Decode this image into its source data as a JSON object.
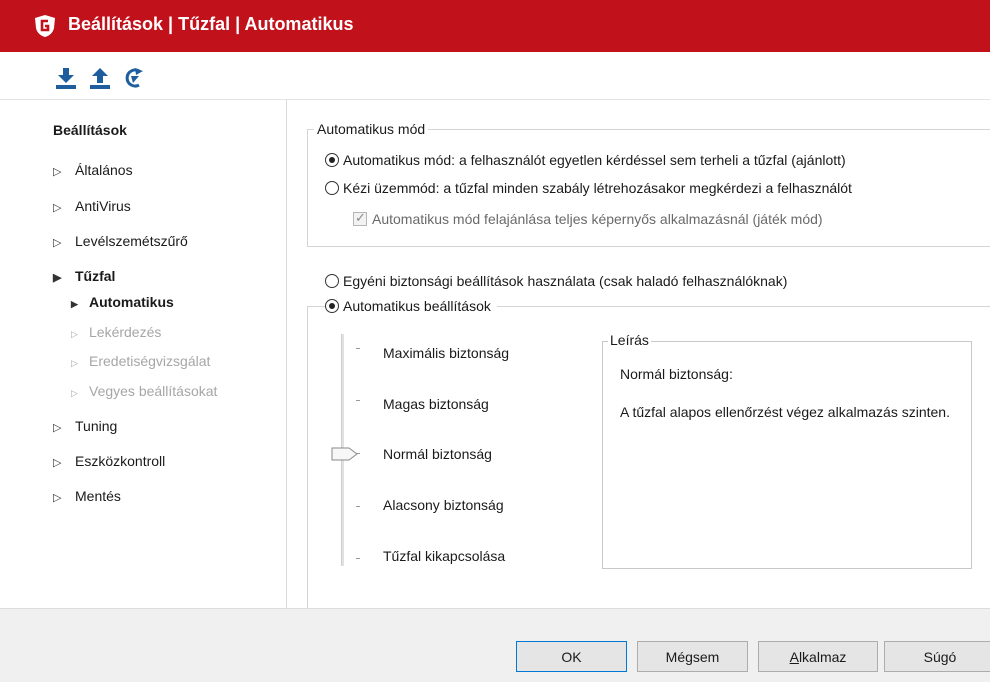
{
  "window": {
    "title": "Beállítások | Tűzfal | Automatikus",
    "accent": "#c1121c"
  },
  "toolbar": {
    "icons": [
      "import-icon",
      "export-icon",
      "reset-icon"
    ],
    "icon_color": "#1f5e9e"
  },
  "sidebar": {
    "header": "Beállítások",
    "items": [
      {
        "label": "Általános"
      },
      {
        "label": "AntiVirus"
      },
      {
        "label": "Levélszemétszűrő"
      },
      {
        "label": "Tűzfal"
      },
      {
        "label": "Tuning"
      },
      {
        "label": "Eszközkontroll"
      },
      {
        "label": "Mentés"
      }
    ],
    "subitems": [
      {
        "label": "Automatikus"
      },
      {
        "label": "Lekérdezés"
      },
      {
        "label": "Eredetiségvizsgálat"
      },
      {
        "label": "Vegyes beállításokat"
      }
    ]
  },
  "auto_mode_group": {
    "legend": "Automatikus mód",
    "option_auto": "Automatikus mód: a felhasználót egyetlen kérdéssel sem terheli a tűzfal (ajánlott)",
    "option_manual": "Kézi üzemmód: a tűzfal minden szabály létrehozásakor megkérdezi a felhasználót",
    "game_mode_checkbox": "Automatikus mód felajánlása teljes képernyős alkalmazásnál (játék mód)",
    "selected": "auto"
  },
  "security": {
    "option_custom": "Egyéni biztonsági beállítások használata (csak haladó felhasználóknak)",
    "option_auto": "Automatikus beállítások",
    "selected": "auto",
    "levels": [
      "Maximális biztonság",
      "Magas biztonság",
      "Normál biztonság",
      "Alacsony biztonság",
      "Tűzfal kikapcsolása"
    ],
    "selected_level": "Normál biztonság"
  },
  "description": {
    "legend": "Leírás",
    "title": "Normál biztonság:",
    "body": "A tűzfal alapos ellenőrzést végez alkalmazás szinten."
  },
  "buttons": {
    "ok": "OK",
    "cancel": "Mégsem",
    "apply_first": "A",
    "apply_rest": "lkalmaz",
    "help": "Súgó"
  }
}
